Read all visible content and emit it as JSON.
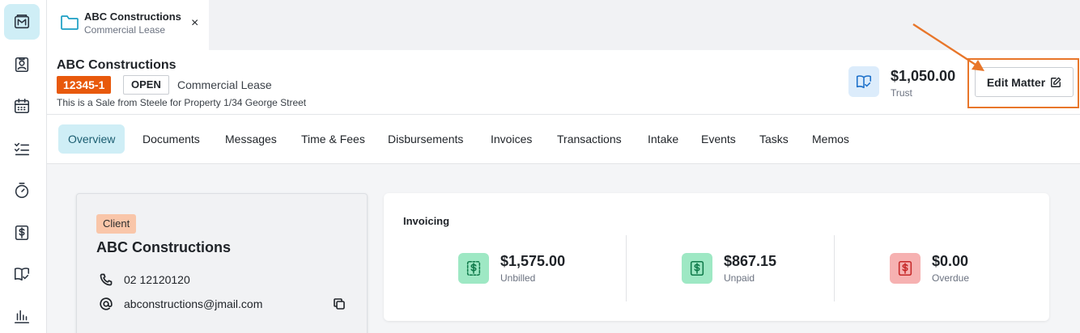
{
  "tab": {
    "title": "ABC Constructions",
    "subtitle": "Commercial Lease",
    "close": "×"
  },
  "matter": {
    "name": "ABC Constructions",
    "number": "12345-1",
    "status": "OPEN",
    "type": "Commercial Lease",
    "description": "This is a Sale from Steele for Property 1/34 George Street"
  },
  "trust": {
    "amount": "$1,050.00",
    "label": "Trust"
  },
  "edit_button": {
    "label": "Edit Matter"
  },
  "nav": [
    "Overview",
    "Documents",
    "Messages",
    "Time & Fees",
    "Disbursements",
    "Invoices",
    "Transactions",
    "Intake",
    "Events",
    "Tasks",
    "Memos"
  ],
  "client": {
    "tag": "Client",
    "name": "ABC Constructions",
    "phone": "02 12120120",
    "email": "abconstructions@jmail.com"
  },
  "invoicing": {
    "title": "Invoicing",
    "unbilled": {
      "value": "$1,575.00",
      "label": "Unbilled"
    },
    "unpaid": {
      "value": "$867.15",
      "label": "Unpaid"
    },
    "overdue": {
      "value": "$0.00",
      "label": "Overdue"
    }
  },
  "colors": {
    "accent": "#e8590c",
    "active_tab": "#cfeef6",
    "highlight": "#e8762a",
    "unbilled_bg": "#9ee8c4",
    "unpaid_bg": "#9ee8c4",
    "overdue_bg": "#f6b1b1"
  },
  "icons": {
    "sidebar": [
      "matters-icon",
      "contacts-icon",
      "calendar-icon",
      "tasks-icon",
      "timer-icon",
      "billing-icon",
      "trust-book-icon",
      "reports-icon"
    ],
    "tab": "folder-icon",
    "trust": "trust-book-icon",
    "edit": "edit-icon",
    "phone": "phone-icon",
    "email": "at-icon",
    "copy": "copy-icon"
  }
}
